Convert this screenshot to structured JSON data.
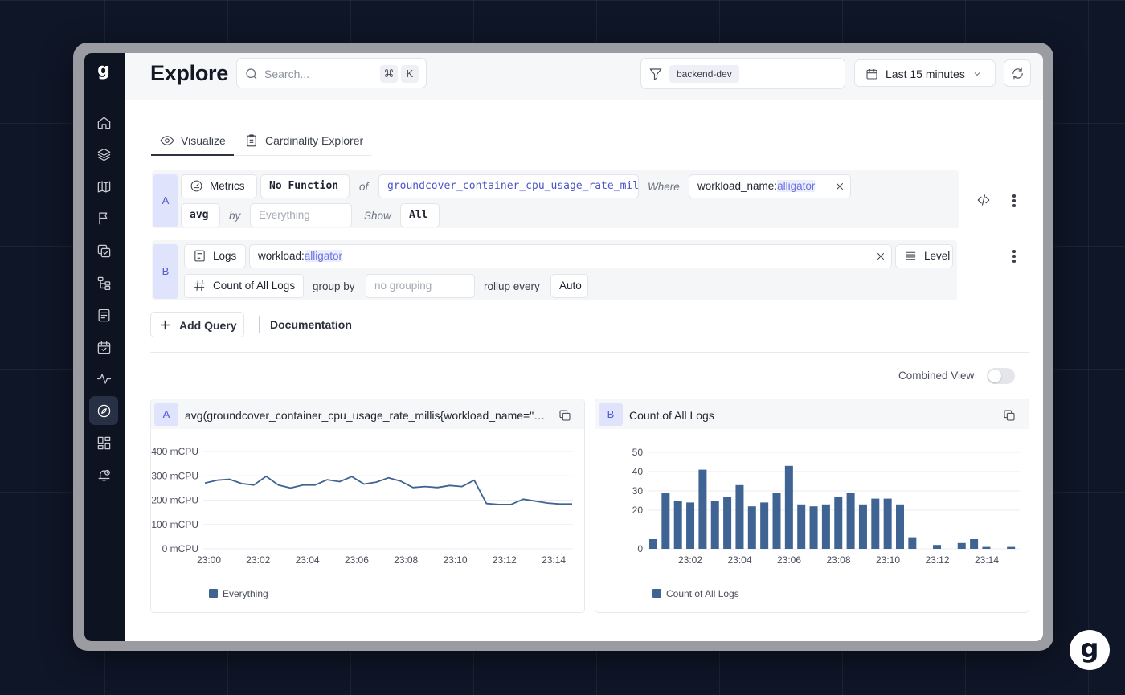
{
  "app": {
    "logo": "g",
    "page_title": "Explore"
  },
  "header": {
    "search_placeholder": "Search...",
    "shortcut_cmd": "⌘",
    "shortcut_key": "K",
    "env_filter": "backend-dev",
    "time_range": "Last 15 minutes"
  },
  "tabs": [
    {
      "label": "Visualize",
      "active": true
    },
    {
      "label": "Cardinality Explorer",
      "active": false
    }
  ],
  "query_a": {
    "letter": "A",
    "source": "Metrics",
    "function": "No Function",
    "of_label": "of",
    "metric": "groundcover_container_cpu_usage_rate_millis",
    "where_label": "Where",
    "filter_key": "workload_name:",
    "filter_value": "alligator",
    "aggregation": "avg",
    "by_label": "by",
    "by_placeholder": "Everything",
    "show_label": "Show",
    "show_value": "All"
  },
  "query_b": {
    "letter": "B",
    "source": "Logs",
    "filter_key": "workload:",
    "filter_value": "alligator",
    "level_label": "Level",
    "aggregation": "Count of All Logs",
    "group_by_label": "group by",
    "group_by_placeholder": "no grouping",
    "rollup_label": "rollup every",
    "rollup_value": "Auto"
  },
  "actions": {
    "add_query": "Add Query",
    "documentation": "Documentation",
    "combined_view": "Combined View",
    "combined_view_on": false
  },
  "colors": {
    "series": "#3f6393",
    "accent": "#4e5bd1",
    "sidebar_bg": "#0e1321"
  },
  "sidebar": [
    {
      "name": "home-icon",
      "active": false
    },
    {
      "name": "layers-icon",
      "active": false
    },
    {
      "name": "map-icon",
      "active": false
    },
    {
      "name": "flag-icon",
      "active": false
    },
    {
      "name": "copy-check-icon",
      "active": false
    },
    {
      "name": "tree-icon",
      "active": false
    },
    {
      "name": "document-icon",
      "active": false
    },
    {
      "name": "calendar-check-icon",
      "active": false
    },
    {
      "name": "activity-icon",
      "active": false
    },
    {
      "name": "compass-icon",
      "active": true
    },
    {
      "name": "dashboard-icon",
      "active": false
    },
    {
      "name": "bell-alert-icon",
      "active": false
    }
  ],
  "chart_data": [
    {
      "type": "line",
      "letter": "A",
      "title": "avg(groundcover_container_cpu_usage_rate_millis{workload_name=\"al...",
      "x_ticks": [
        "23:00",
        "23:02",
        "23:04",
        "23:06",
        "23:08",
        "23:10",
        "23:12",
        "23:14"
      ],
      "y_ticks": [
        "400 mCPU",
        "300 mCPU",
        "200 mCPU",
        "100 mCPU",
        "0 mCPU"
      ],
      "ylim": [
        0,
        400
      ],
      "grid": true,
      "series": [
        {
          "name": "Everything",
          "values": [
            270,
            282,
            286,
            268,
            262,
            298,
            262,
            250,
            262,
            262,
            284,
            276,
            297,
            266,
            274,
            292,
            278,
            252,
            256,
            252,
            260,
            256,
            282,
            186,
            182,
            182,
            204,
            196,
            188,
            184,
            184
          ]
        }
      ],
      "legend": "bottom-left"
    },
    {
      "type": "bar",
      "letter": "B",
      "title": "Count of All Logs",
      "x_ticks": [
        "23:02",
        "23:04",
        "23:06",
        "23:08",
        "23:10",
        "23:12",
        "23:14"
      ],
      "y_ticks": [
        "50",
        "40",
        "30",
        "20",
        "0"
      ],
      "ylim": [
        0,
        50
      ],
      "grid": true,
      "series": [
        {
          "name": "Count of All Logs",
          "values": [
            5,
            29,
            25,
            24,
            41,
            25,
            27,
            33,
            22,
            24,
            29,
            43,
            23,
            22,
            23,
            27,
            29,
            23,
            26,
            26,
            23,
            6,
            0,
            2,
            0,
            3,
            5,
            1,
            0,
            1
          ]
        }
      ],
      "legend": "bottom-left"
    }
  ]
}
